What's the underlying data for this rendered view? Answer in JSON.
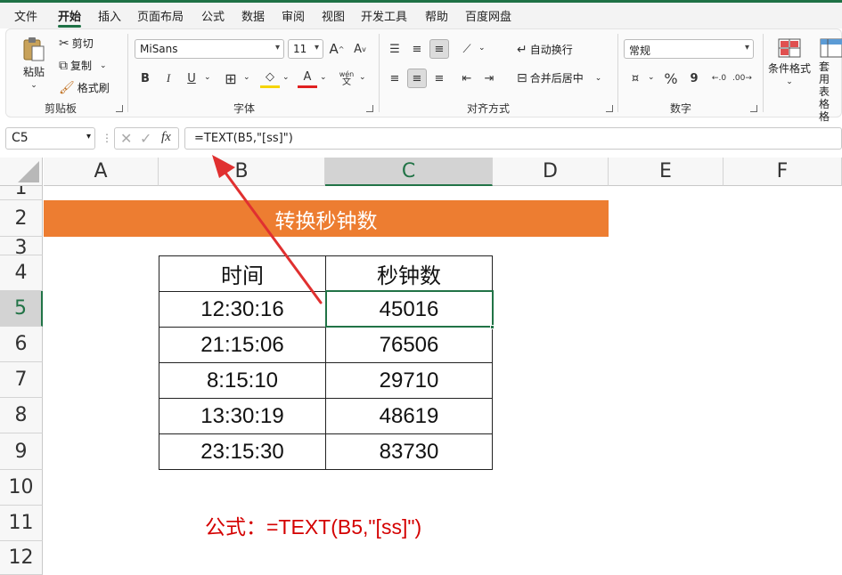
{
  "menu": {
    "items": [
      "文件",
      "开始",
      "插入",
      "页面布局",
      "公式",
      "数据",
      "审阅",
      "视图",
      "开发工具",
      "帮助",
      "百度网盘"
    ],
    "active_index": 1
  },
  "ribbon": {
    "clipboard": {
      "paste": "粘贴",
      "cut": "剪切",
      "copy": "复制",
      "format_painter": "格式刷",
      "label": "剪贴板"
    },
    "font": {
      "name": "MiSans",
      "size": "11",
      "grow": "A",
      "shrink": "A",
      "bold": "B",
      "italic": "I",
      "underline": "U",
      "phonetic": "wén",
      "label": "字体"
    },
    "alignment": {
      "wrap": "自动换行",
      "merge": "合并后居中",
      "label": "对齐方式"
    },
    "number": {
      "format": "常规",
      "percent": "%",
      "comma": "9",
      "label": "数字"
    },
    "styles": {
      "conditional": "条件格式",
      "table": "套用表格格"
    }
  },
  "formula_bar": {
    "name_box": "C5",
    "fx": "fx",
    "formula": "=TEXT(B5,\"[ss]\")"
  },
  "sheet": {
    "columns": [
      "A",
      "B",
      "C",
      "D",
      "E",
      "F"
    ],
    "rows": [
      "1",
      "2",
      "3",
      "4",
      "5",
      "6",
      "7",
      "8",
      "9",
      "10",
      "11",
      "12"
    ],
    "selected_column": "C",
    "selected_row": "5",
    "banner_title": "转换秒钟数",
    "table_headers": [
      "时间",
      "秒钟数"
    ],
    "table_rows": [
      [
        "12:30:16",
        "45016"
      ],
      [
        "21:15:06",
        "76506"
      ],
      [
        "8:15:10",
        "29710"
      ],
      [
        "13:30:19",
        "48619"
      ],
      [
        "23:15:30",
        "83730"
      ]
    ],
    "formula_note": "公式：=TEXT(B5,\"[ss]\")"
  },
  "colors": {
    "accent": "#1e7145",
    "banner": "#ed7d31",
    "arrow": "#e03030",
    "note": "#d40000"
  }
}
